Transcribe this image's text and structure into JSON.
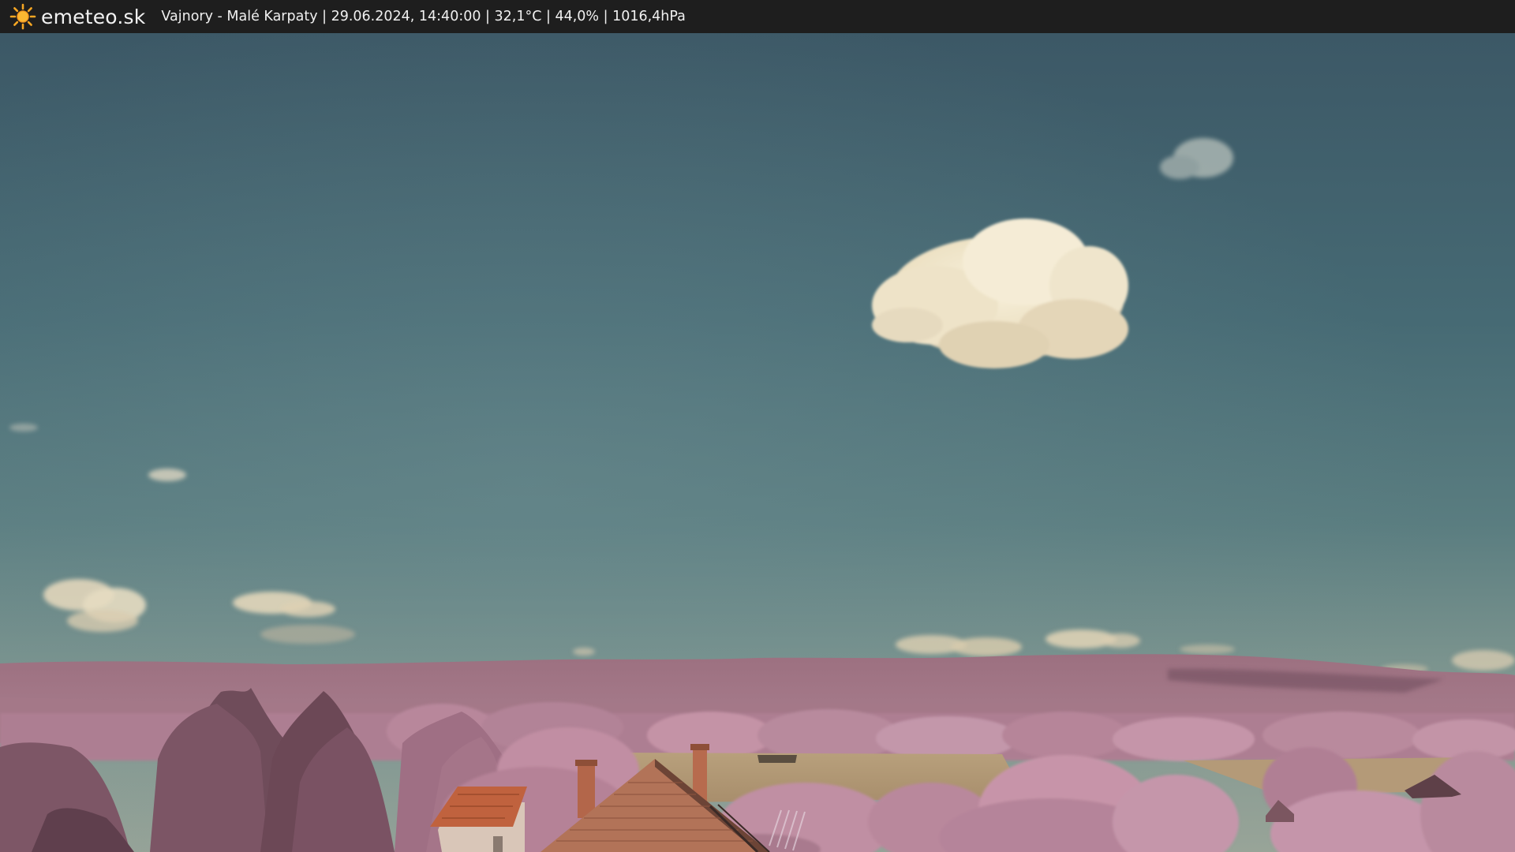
{
  "header": {
    "brand": "emeteo.sk",
    "caption": "Vajnory - Malé Karpaty | 29.06.2024, 14:40:00 | 32,1°C | 44,0% | 1016,4hPa",
    "logo_icon": "sun-icon"
  },
  "colors": {
    "bar": "#1e1e1e",
    "sky_top": "#3e5a68",
    "sky_horizon": "#7f9590",
    "foliage": "#b07a92",
    "roof": "#b8603e"
  }
}
